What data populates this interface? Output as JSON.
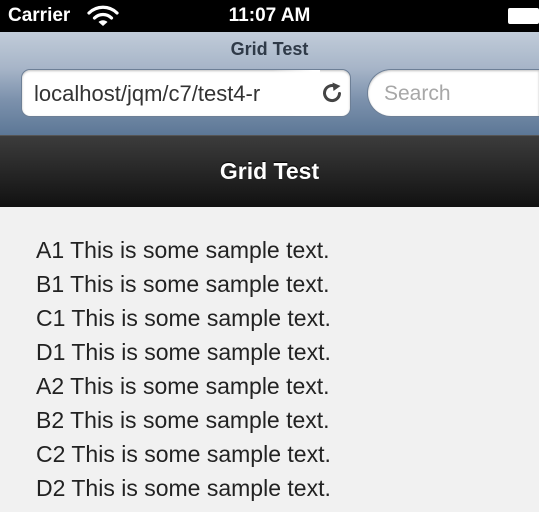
{
  "status_bar": {
    "carrier": "Carrier",
    "time": "11:07 AM",
    "wifi_icon": "wifi-icon",
    "battery_icon": "battery-icon"
  },
  "browser": {
    "page_title": "Grid Test",
    "url": "localhost/jqm/c7/test4-r",
    "reload_icon": "reload-icon",
    "search_placeholder": "Search"
  },
  "header": {
    "title": "Grid Test"
  },
  "content": {
    "items": [
      "A1 This is some sample text.",
      "B1 This is some sample text.",
      "C1 This is some sample text.",
      "D1 This is some sample text.",
      "A2 This is some sample text.",
      "B2 This is some sample text.",
      "C2 This is some sample text.",
      "D2 This is some sample text."
    ]
  },
  "colors": {
    "status_bar": "#000000",
    "browser_bar": "#7d92ad",
    "header": "#222222",
    "content_bg": "#f1f1f1"
  }
}
